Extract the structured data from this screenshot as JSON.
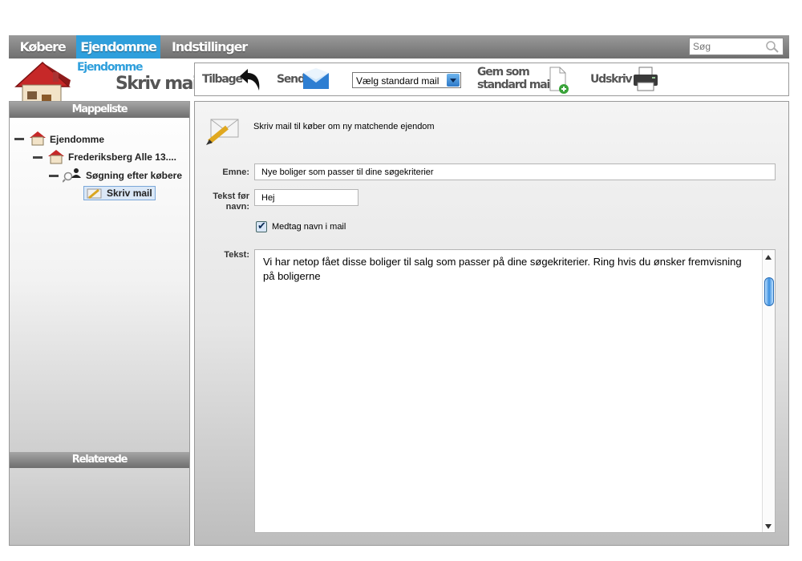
{
  "nav": {
    "tabs": [
      {
        "label": "Købere",
        "active": false
      },
      {
        "label": "Ejendomme",
        "active": true
      },
      {
        "label": "Indstillinger",
        "active": false
      }
    ],
    "search_placeholder": "Søg",
    "accent_color": "#2f9fdc"
  },
  "header": {
    "section": "Ejendomme",
    "title": "Skriv mail"
  },
  "toolbar": {
    "back_label": "Tilbage",
    "send_label": "Send",
    "template_select_value": "Vælg standard mail",
    "save_line1": "Gem som",
    "save_line2": "standard mail",
    "print_label": "Udskriv"
  },
  "sidebar": {
    "folder_header": "Mappeliste",
    "related_header": "Relaterede",
    "tree": [
      {
        "label": "Ejendomme",
        "icon": "house-icon"
      },
      {
        "label": "Frederiksberg Alle 13....",
        "icon": "house-icon"
      },
      {
        "label": "Søgning efter købere",
        "icon": "search-person-icon"
      },
      {
        "label": "Skriv mail",
        "icon": "pencil-envelope-icon",
        "selected": true
      }
    ]
  },
  "form": {
    "intro": "Skriv mail til køber om ny matchende ejendom",
    "subject_label": "Emne:",
    "subject_value": "Nye boliger som passer til dine søgekriterier",
    "pre_name_label_line1": "Tekst før",
    "pre_name_label_line2": "navn:",
    "pre_name_value": "Hej",
    "include_name_label": "Medtag navn i mail",
    "include_name_checked": true,
    "text_label": "Tekst:",
    "text_value": "Vi har netop fået disse boliger til salg som passer på dine søgekriterier. Ring hvis du ønsker fremvisning på boligerne"
  }
}
